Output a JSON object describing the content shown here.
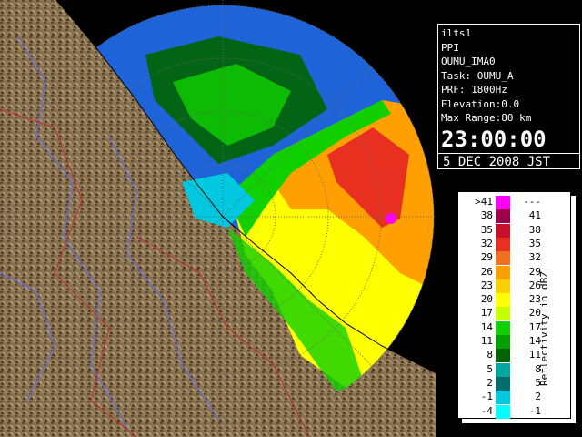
{
  "info": {
    "station": "ilts1",
    "mode": "PPI",
    "site": "OUMU_IMA0",
    "task": "Task: OUMU_A",
    "prf": "PRF: 1800Hz",
    "elevation": "Elevation:0.0",
    "max_range": "Max Range:80 km",
    "time": "23:00:00",
    "date": "5 DEC 2008 JST"
  },
  "legend": {
    "unit": "Reflectivity in dBZ",
    "rows": [
      {
        "lo": ">41",
        "hi": "---",
        "color": "#ff00ff"
      },
      {
        "lo": "38",
        "hi": "41",
        "color": "#a0004a"
      },
      {
        "lo": "35",
        "hi": "38",
        "color": "#c8102a"
      },
      {
        "lo": "32",
        "hi": "35",
        "color": "#e83020"
      },
      {
        "lo": "29",
        "hi": "32",
        "color": "#f07020"
      },
      {
        "lo": "26",
        "hi": "29",
        "color": "#ffa000"
      },
      {
        "lo": "23",
        "hi": "26",
        "color": "#ffd000"
      },
      {
        "lo": "20",
        "hi": "23",
        "color": "#ffff00"
      },
      {
        "lo": "17",
        "hi": "20",
        "color": "#c8ff00"
      },
      {
        "lo": "14",
        "hi": "17",
        "color": "#10d000"
      },
      {
        "lo": "11",
        "hi": "14",
        "color": "#00a000"
      },
      {
        "lo": "8",
        "hi": "11",
        "color": "#006400"
      },
      {
        "lo": "5",
        "hi": "8",
        "color": "#00a8a0"
      },
      {
        "lo": "2",
        "hi": "5",
        "color": "#006e6e"
      },
      {
        "lo": "-1",
        "hi": "2",
        "color": "#00c8e0"
      },
      {
        "lo": "-4",
        "hi": "-1",
        "color": "#00ffff"
      }
    ]
  },
  "colors": {
    "land": "#8a7352",
    "sea": "#1e64d8",
    "background": "#000000",
    "rivers": "#5a6eff",
    "borders": "#c03030"
  }
}
